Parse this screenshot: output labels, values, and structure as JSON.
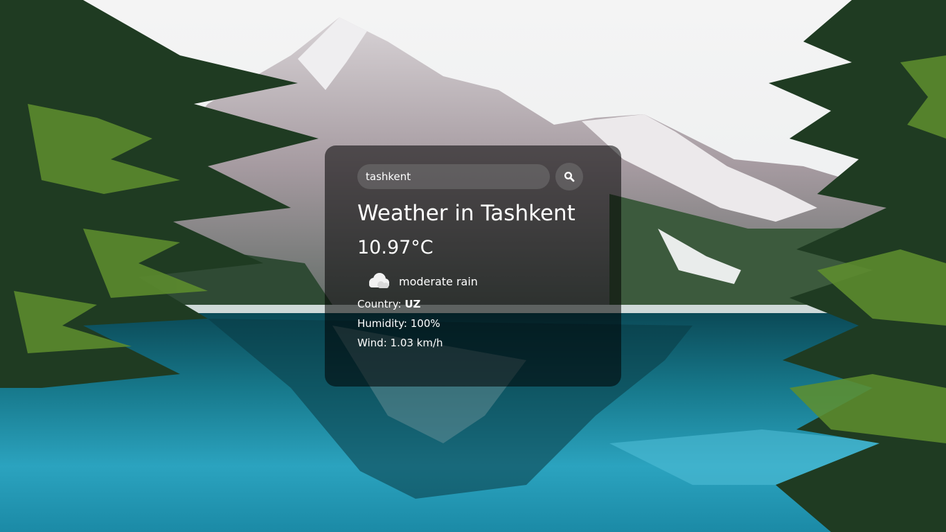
{
  "search": {
    "value": "tashkent",
    "placeholder": "Search"
  },
  "weather": {
    "title": "Weather in Tashkent",
    "temperature": "10.97°C",
    "icon": "cloud-rain-icon",
    "description": "moderate rain",
    "country_label": "Country: ",
    "country_value": "UZ",
    "humidity": "Humidity: 100%",
    "wind": "Wind: 1.03 km/h"
  },
  "colors": {
    "card_background": "#000000",
    "text": "#ffffff",
    "lake": "#1a8fa8"
  }
}
